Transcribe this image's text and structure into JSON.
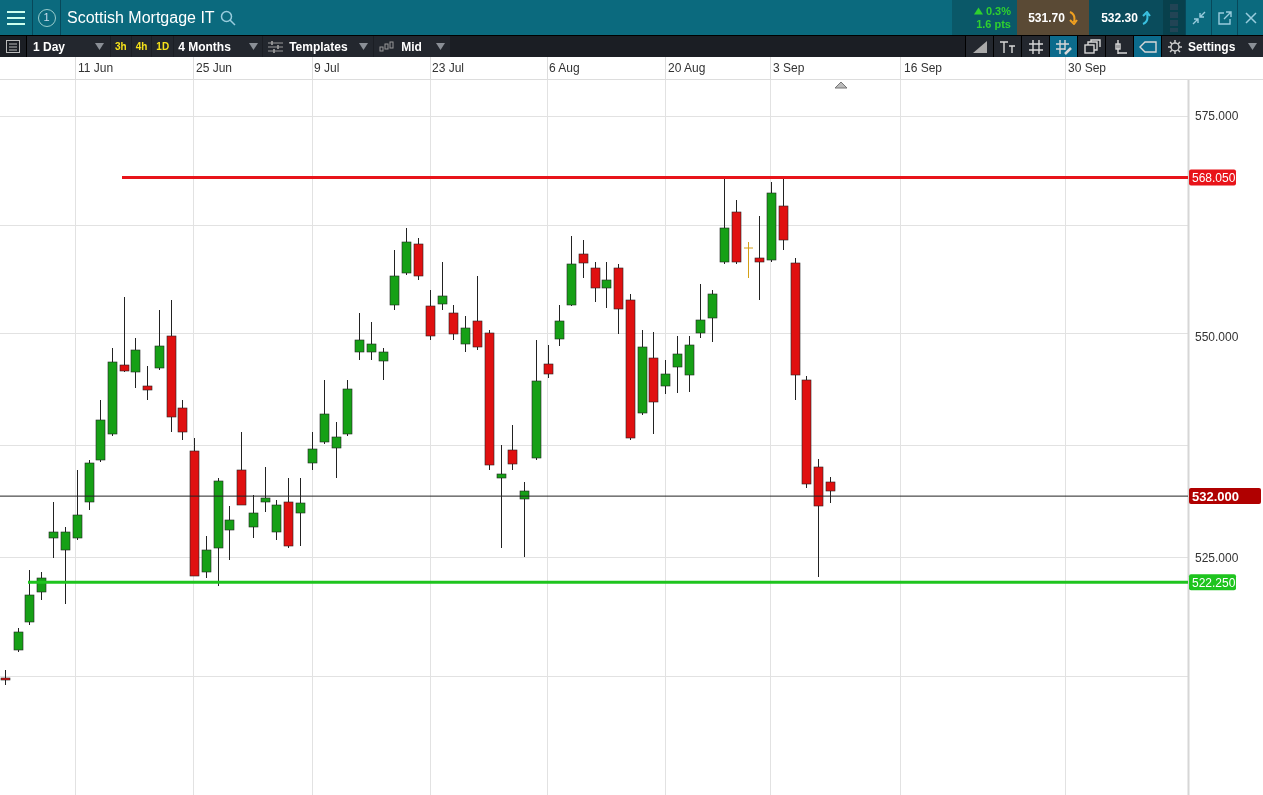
{
  "header": {
    "badge": "1",
    "title": "Scottish Mortgage IT",
    "change": {
      "percent": "0.3%",
      "points": "1.6 pts",
      "rising": true
    },
    "sell": "531.70",
    "buy": "532.30"
  },
  "toolbar": {
    "interval": "1 Day",
    "quick_intervals": [
      {
        "label": "3h"
      },
      {
        "label": "4h"
      },
      {
        "label": "1D"
      }
    ],
    "range": "4 Months",
    "templates": "Templates",
    "price_type": "Mid",
    "tools": [
      {
        "kind": "trend",
        "selected": false
      },
      {
        "kind": "text",
        "selected": false
      },
      {
        "kind": "grid",
        "selected": false
      },
      {
        "kind": "draw",
        "selected": true
      },
      {
        "kind": "layers",
        "selected": false
      },
      {
        "kind": "candle",
        "selected": false
      },
      {
        "kind": "tag",
        "selected": true
      }
    ],
    "settings": "Settings"
  },
  "chart": {
    "x_labels": [
      "11 Jun",
      "25 Jun",
      "9 Jul",
      "23 Jul",
      "6 Aug",
      "20 Aug",
      "3 Sep",
      "16 Sep",
      "30 Sep"
    ],
    "y_labels": [
      "575.000",
      "550.000",
      "525.000"
    ],
    "lines": [
      {
        "kind": "level",
        "label": "568.050",
        "color": "#e8141a"
      },
      {
        "kind": "current",
        "label": "532.000",
        "color": "#b00000"
      },
      {
        "kind": "level",
        "label": "522.250",
        "color": "#1ec41e"
      }
    ]
  }
}
